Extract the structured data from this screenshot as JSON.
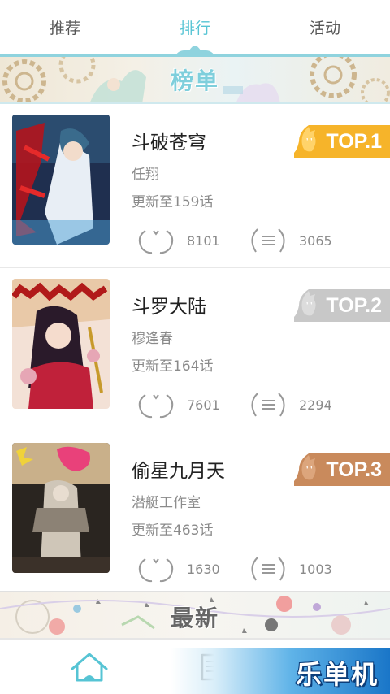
{
  "tabs": [
    {
      "label": "推荐",
      "active": false
    },
    {
      "label": "排行",
      "active": true
    },
    {
      "label": "活动",
      "active": false
    }
  ],
  "banner_top": {
    "title": "榜单"
  },
  "banner_new": {
    "title": "最新"
  },
  "rankings": [
    {
      "title": "斗破苍穹",
      "author": "任翔",
      "update": "更新至159话",
      "likes": "8101",
      "comments": "3065",
      "rank_label": "TOP.1",
      "rank_color": "#f6b42a"
    },
    {
      "title": "斗罗大陆",
      "author": "穆逢春",
      "update": "更新至164话",
      "likes": "7601",
      "comments": "2294",
      "rank_label": "TOP.2",
      "rank_color": "#c8c8c8"
    },
    {
      "title": "偷星九月天",
      "author": "潜艇工作室",
      "update": "更新至463话",
      "likes": "1630",
      "comments": "1003",
      "rank_label": "TOP.3",
      "rank_color": "#c98a5c"
    }
  ],
  "bottom_nav": {
    "brand": "乐单机",
    "home_icon": "home-icon",
    "book_icon": "book-icon"
  },
  "colors": {
    "accent": "#56c4d4",
    "tab_line": "#8fd3de"
  }
}
